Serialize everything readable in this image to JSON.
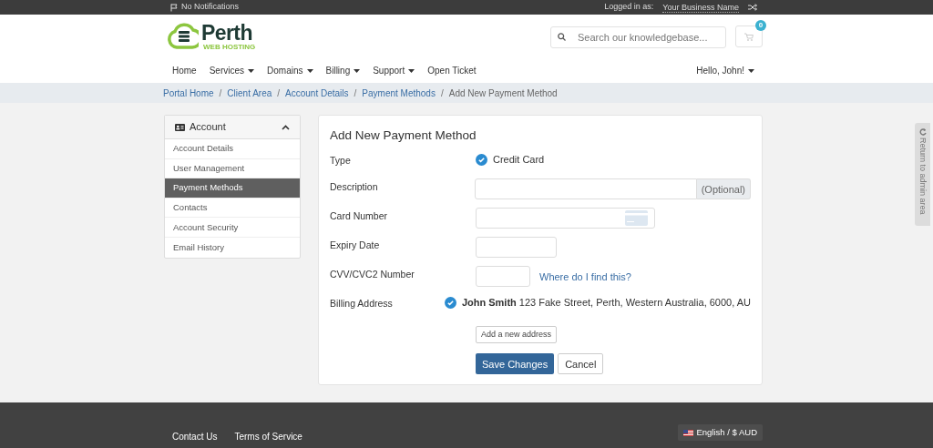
{
  "top_bar": {
    "notifications": "No Notifications",
    "logged_in_label": "Logged in as:",
    "business_name": "Your Business Name"
  },
  "header": {
    "logo_name": "Perth",
    "logo_tagline": "WEB HOSTING",
    "search": {
      "placeholder": "Search our knowledgebase..."
    },
    "cart_count": "0"
  },
  "nav": {
    "items": [
      {
        "label": "Home",
        "dropdown": false
      },
      {
        "label": "Services",
        "dropdown": true
      },
      {
        "label": "Domains",
        "dropdown": true
      },
      {
        "label": "Billing",
        "dropdown": true
      },
      {
        "label": "Support",
        "dropdown": true
      },
      {
        "label": "Open Ticket",
        "dropdown": false
      }
    ],
    "user": "Hello, John!"
  },
  "breadcrumb": {
    "separator": "/",
    "items": [
      {
        "label": "Portal Home",
        "link": true
      },
      {
        "label": "Client Area",
        "link": true
      },
      {
        "label": "Account Details",
        "link": true
      },
      {
        "label": "Payment Methods",
        "link": true
      },
      {
        "label": "Add New Payment Method",
        "link": false
      }
    ]
  },
  "sidebar": {
    "title": "Account",
    "expanded": true,
    "items": [
      {
        "label": "Account Details",
        "selected": false
      },
      {
        "label": "User Management",
        "selected": false
      },
      {
        "label": "Payment Methods",
        "selected": true
      },
      {
        "label": "Contacts",
        "selected": false
      },
      {
        "label": "Account Security",
        "selected": false
      },
      {
        "label": "Email History",
        "selected": false
      }
    ]
  },
  "form": {
    "title": "Add New Payment Method",
    "rows": [
      {
        "kind": "radio",
        "label": "Type",
        "option": "Credit Card",
        "selected": true
      },
      {
        "kind": "addon",
        "label": "Description",
        "addon": "(Optional)"
      },
      {
        "kind": "card",
        "label": "Card Number"
      },
      {
        "kind": "short",
        "label": "Expiry Date"
      },
      {
        "kind": "help",
        "label": "CVV/CVC2 Number",
        "link": "Where do I find this?"
      },
      {
        "kind": "address",
        "label": "Billing Address",
        "name": "John Smith",
        "address": "123 Fake Street, Perth, Western Australia, 6000, AU",
        "selected": true
      }
    ],
    "add_address": "Add a new address",
    "save": "Save Changes",
    "cancel": "Cancel"
  },
  "admin_tab": "Return to admin area",
  "footer": {
    "links": [
      "Contact Us",
      "Terms of Service"
    ],
    "language": "English / $ AUD"
  }
}
